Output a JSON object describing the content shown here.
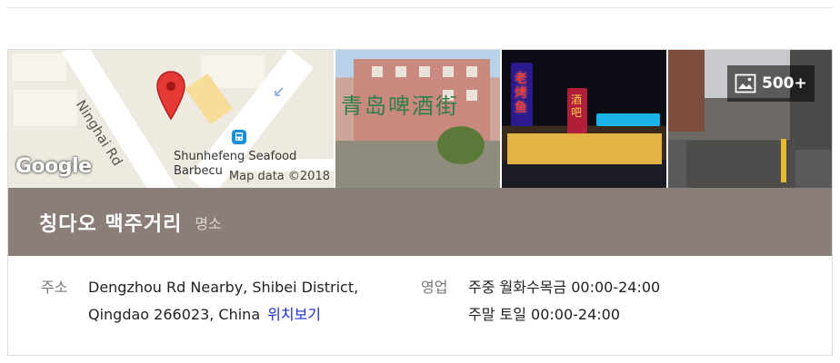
{
  "map": {
    "street_label": "Ninghai Rd",
    "place_label_line1": "Shunhefeng Seafood",
    "place_label_line2": "Barbecu",
    "logo": "Google",
    "map_data": "Map data ©2018",
    "icons": [
      "location-pin-icon",
      "bus-stop-icon",
      "one-way-arrow-icon"
    ]
  },
  "photos": {
    "sign_text_1": "青岛啤酒街",
    "neon_text_1": "老烤鱼",
    "neon_text_2": "酒吧",
    "more_count": "500+",
    "more_icon": "gallery-icon"
  },
  "header": {
    "name": "칭다오 맥주거리",
    "category": "명소"
  },
  "details": {
    "address_label": "주소",
    "address_line1": "Dengzhou Rd Nearby, Shibei District,",
    "address_line2": "Qingdao 266023, China",
    "map_link": "위치보기",
    "hours_label": "영업",
    "hours_weekday": "주중 월화수목금 00:00-24:00",
    "hours_weekend": "주말 토일 00:00-24:00"
  },
  "colors": {
    "title_band": "#8b7e79",
    "link": "#1a2ecc",
    "pin": "#e53935"
  }
}
